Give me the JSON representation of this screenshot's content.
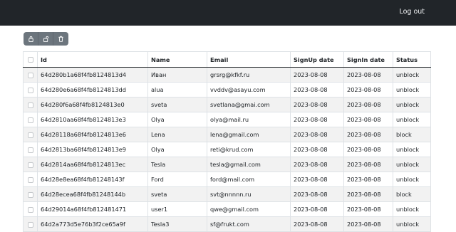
{
  "navbar": {
    "logout_label": "Log out"
  },
  "toolbar": {
    "buttons": [
      {
        "name": "lock-button",
        "icon": "lock-icon"
      },
      {
        "name": "unlock-button",
        "icon": "unlock-icon"
      },
      {
        "name": "delete-button",
        "icon": "trash-icon"
      }
    ]
  },
  "table": {
    "headers": [
      "Id",
      "Name",
      "Email",
      "SignUp date",
      "SignIn date",
      "Status"
    ],
    "rows": [
      [
        "64d280b1a68f4fb8124813d4",
        "Иван",
        "grsrg@kfkf.ru",
        "2023-08-08",
        "2023-08-08",
        "unblock"
      ],
      [
        "64d280e6a68f4fb8124813dd",
        "alua",
        "vvddv@asayu.com",
        "2023-08-08",
        "2023-08-08",
        "unblock"
      ],
      [
        "64d280f6a68f4fb8124813e0",
        "sveta",
        "svetlana@gmai.com",
        "2023-08-08",
        "2023-08-08",
        "unblock"
      ],
      [
        "64d2810aa68f4fb8124813e3",
        "Olya",
        "olya@mail.ru",
        "2023-08-08",
        "2023-08-08",
        "unblock"
      ],
      [
        "64d28118a68f4fb8124813e6",
        "Lena",
        "lena@gmail.com",
        "2023-08-08",
        "2023-08-08",
        "block"
      ],
      [
        "64d2813ba68f4fb8124813e9",
        "Olya",
        "reti@krud.com",
        "2023-08-08",
        "2023-08-08",
        "unblock"
      ],
      [
        "64d2814aa68f4fb8124813ec",
        "Tesla",
        "tesla@gmail.com",
        "2023-08-08",
        "2023-08-08",
        "unblock"
      ],
      [
        "64d28e8ea68f4fb81248143f",
        "Ford",
        "ford@mail.com",
        "2023-08-08",
        "2023-08-08",
        "unblock"
      ],
      [
        "64d28ecea68f4fb81248144b",
        "sveta",
        "svt@nnnnn.ru",
        "2023-08-08",
        "2023-08-08",
        "block"
      ],
      [
        "64d29014a68f4fb812481471",
        "user1",
        "qwe@gmail.com",
        "2023-08-08",
        "2023-08-08",
        "unblock"
      ],
      [
        "64d2a773d5e76b3f2ce65a9f",
        "Tesla3",
        "sf@frukt.com",
        "2023-08-08",
        "2023-08-08",
        "unblock"
      ]
    ]
  }
}
